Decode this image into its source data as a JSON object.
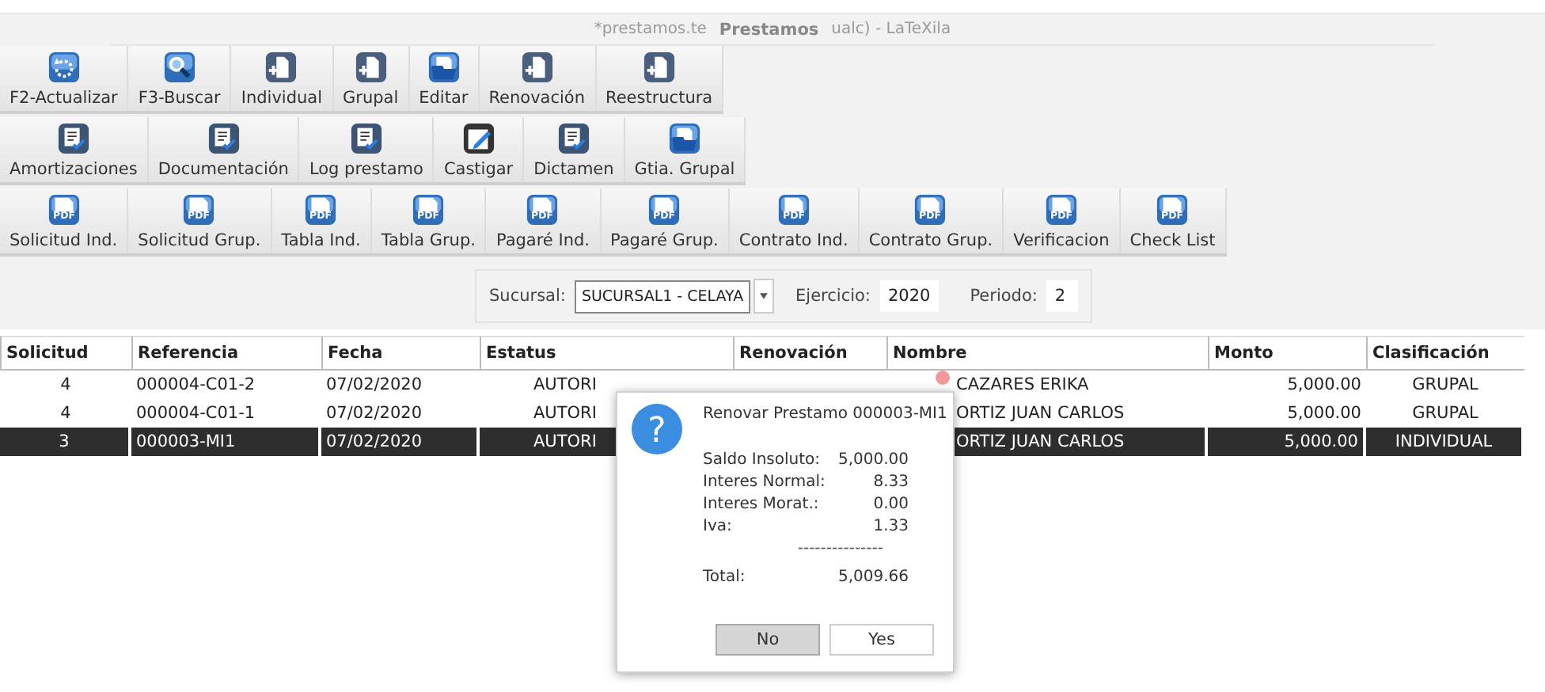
{
  "window": {
    "title": "Prestamos",
    "background_title_left": "*prestamos.te",
    "background_title_right": "ualc) - LaTeXila"
  },
  "toolbars": [
    [
      {
        "label": "F2-Actualizar",
        "kind": "refresh"
      },
      {
        "label": "F3-Buscar",
        "kind": "search"
      },
      {
        "label": "Individual",
        "kind": "new"
      },
      {
        "label": "Grupal",
        "kind": "new"
      },
      {
        "label": "Editar",
        "kind": "open"
      },
      {
        "label": "Renovación",
        "kind": "new"
      },
      {
        "label": "Reestructura",
        "kind": "new"
      }
    ],
    [
      {
        "label": "Amortizaciones",
        "kind": "report"
      },
      {
        "label": "Documentación",
        "kind": "report"
      },
      {
        "label": "Log prestamo",
        "kind": "report"
      },
      {
        "label": "Castigar",
        "kind": "edit"
      },
      {
        "label": "Dictamen",
        "kind": "report"
      },
      {
        "label": "Gtia. Grupal",
        "kind": "open"
      }
    ],
    [
      {
        "label": "Solicitud Ind.",
        "kind": "pdf",
        "badge": "PDF"
      },
      {
        "label": "Solicitud Grup.",
        "kind": "pdf",
        "badge": "PDF"
      },
      {
        "label": "Tabla Ind.",
        "kind": "pdf",
        "badge": "PDF"
      },
      {
        "label": "Tabla Grup.",
        "kind": "pdf",
        "badge": "PDF"
      },
      {
        "label": "Pagaré Ind.",
        "kind": "pdf",
        "badge": "PDF"
      },
      {
        "label": "Pagaré Grup.",
        "kind": "pdf",
        "badge": "PDF"
      },
      {
        "label": "Contrato Ind.",
        "kind": "pdf",
        "badge": "PDF"
      },
      {
        "label": "Contrato Grup.",
        "kind": "pdf",
        "badge": "PDF"
      },
      {
        "label": "Verificacion",
        "kind": "pdf",
        "badge": "PDF"
      },
      {
        "label": "Check List",
        "kind": "pdf",
        "badge": "PDF"
      }
    ]
  ],
  "filters": {
    "sucursal_label": "Sucursal:",
    "sucursal_value": "SUCURSAL1 - CELAYA",
    "ejercicio_label": "Ejercicio:",
    "ejercicio_value": "2020",
    "periodo_label": "Periodo:",
    "periodo_value": "2"
  },
  "table": {
    "columns": [
      "Solicitud",
      "Referencia",
      "Fecha",
      "Estatus",
      "Renovación",
      "Nombre",
      "Monto",
      "Clasificación"
    ],
    "rows": [
      {
        "selected": false,
        "cells": [
          "4",
          "000004-C01-2",
          "07/02/2020",
          "AUTORI",
          "",
          "CAZARES ERIKA",
          "5,000.00",
          "GRUPAL"
        ]
      },
      {
        "selected": false,
        "cells": [
          "4",
          "000004-C01-1",
          "07/02/2020",
          "AUTORI",
          "",
          "ORTIZ JUAN CARLOS",
          "5,000.00",
          "GRUPAL"
        ]
      },
      {
        "selected": true,
        "cells": [
          "3",
          "000003-MI1",
          "07/02/2020",
          "AUTORI",
          "",
          "ORTIZ JUAN CARLOS",
          "5,000.00",
          "INDIVIDUAL"
        ]
      }
    ]
  },
  "dialog": {
    "icon_glyph": "?",
    "message": "Renovar Prestamo 000003-MI1",
    "lines": [
      {
        "label": "Saldo Insoluto:",
        "value": "5,000.00"
      },
      {
        "label": "Interes Normal:",
        "value": "8.33"
      },
      {
        "label": "Interes Morat.:",
        "value": "0.00"
      },
      {
        "label": "Iva:",
        "value": "1.33"
      }
    ],
    "rule": "---------------",
    "total_label": "Total:",
    "total_value": "5,009.66",
    "buttons": [
      {
        "label": "No",
        "selected": true
      },
      {
        "label": "Yes",
        "selected": false
      }
    ]
  }
}
